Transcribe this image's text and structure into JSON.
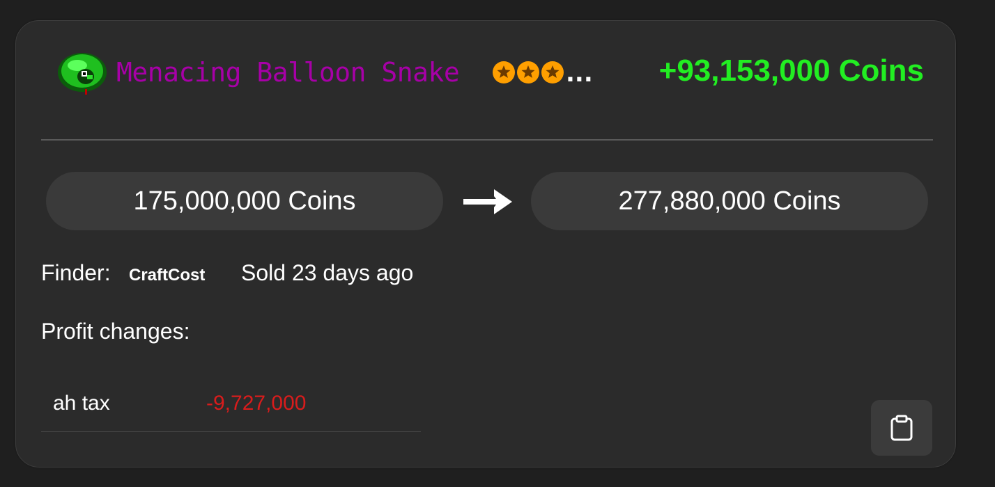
{
  "item": {
    "icon": "balloon-snake-pet-icon",
    "name": "Menacing Balloon Snake",
    "stars_icon": "orange-star-circle-icon",
    "star_count": 3,
    "overflow_indicator": "...",
    "profit_total": "+93,153,000 Coins"
  },
  "prices": {
    "buy": "175,000,000 Coins",
    "arrow_icon": "right-arrow-icon",
    "sell": "277,880,000 Coins"
  },
  "meta": {
    "finder_label": "Finder:",
    "finder_name": "CraftCost",
    "sold_time": "Sold 23 days ago"
  },
  "profit_changes": {
    "label": "Profit changes:",
    "items": [
      {
        "label": "ah tax",
        "value": "-9,727,000"
      }
    ]
  },
  "copy_button": {
    "icon": "clipboard-icon"
  },
  "colors": {
    "background": "#1f1f1f",
    "card": "#2b2b2b",
    "pill": "#3a3a3a",
    "item_name": "#a700a7",
    "profit_positive": "#22ee22",
    "profit_negative": "#d91c1c",
    "star": "#ff9f00"
  }
}
